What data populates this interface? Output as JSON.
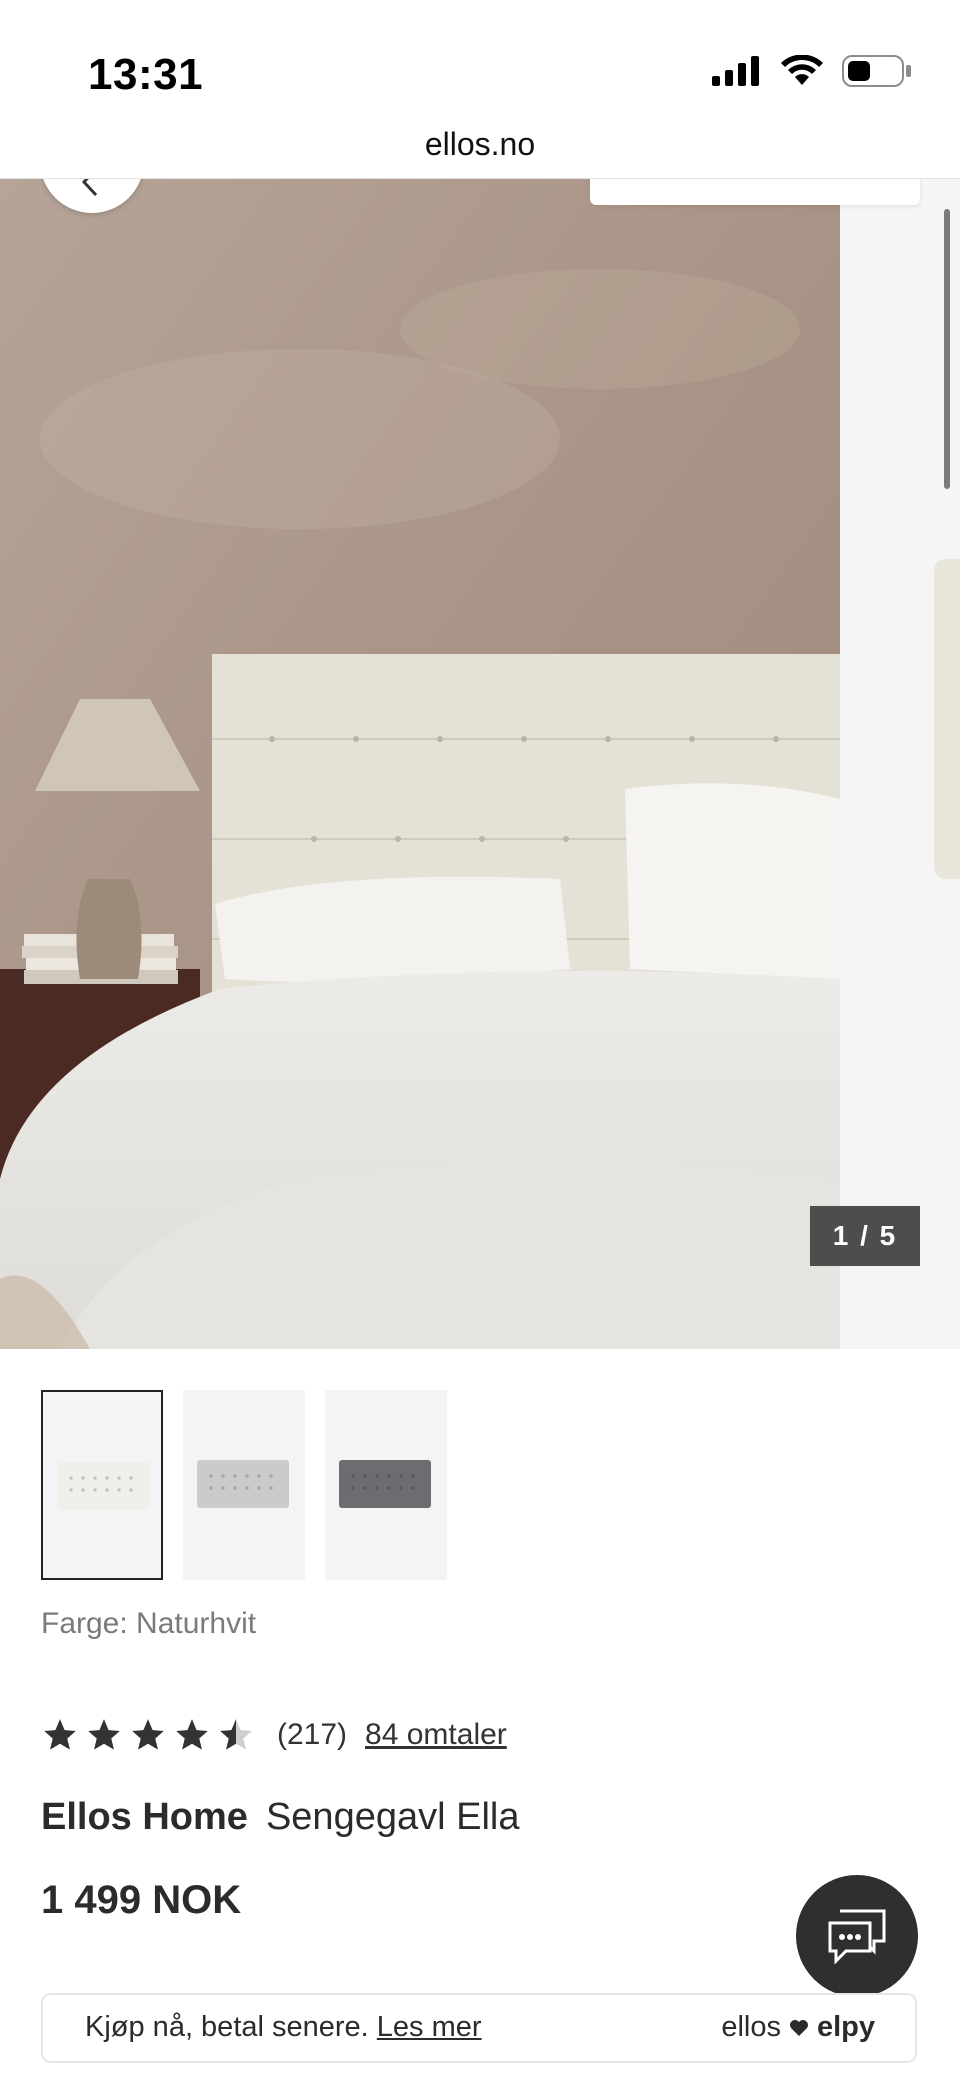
{
  "status_bar": {
    "time": "13:31"
  },
  "browser": {
    "url": "ellos.no"
  },
  "gallery": {
    "counter": "1 / 5",
    "current_image": 1,
    "total_images": 5
  },
  "thumbnails": [
    {
      "color_name": "Naturhvit",
      "swatch": "#f0efe9",
      "selected": true
    },
    {
      "color_name": "Lysegrå",
      "swatch": "#c9cbcc",
      "selected": false
    },
    {
      "color_name": "Mørkegrå",
      "swatch": "#6b6d70",
      "selected": false
    }
  ],
  "product": {
    "color_label": "Farge: Naturhvit",
    "rating": 4.5,
    "rating_count": "(217)",
    "reviews_link": "84 omtaler",
    "brand": "Ellos Home",
    "name": "Sengegavl Ella",
    "price": "1 499 NOK"
  },
  "payment": {
    "text": "Kjøp nå, betal senere.",
    "link": "Les mer",
    "brand_left": "ellos",
    "brand_right": "elpy"
  },
  "icons": [
    "back-arrow-icon",
    "chat-icon",
    "heart-icon",
    "star-icon",
    "signal-icon",
    "wifi-icon",
    "battery-icon"
  ]
}
